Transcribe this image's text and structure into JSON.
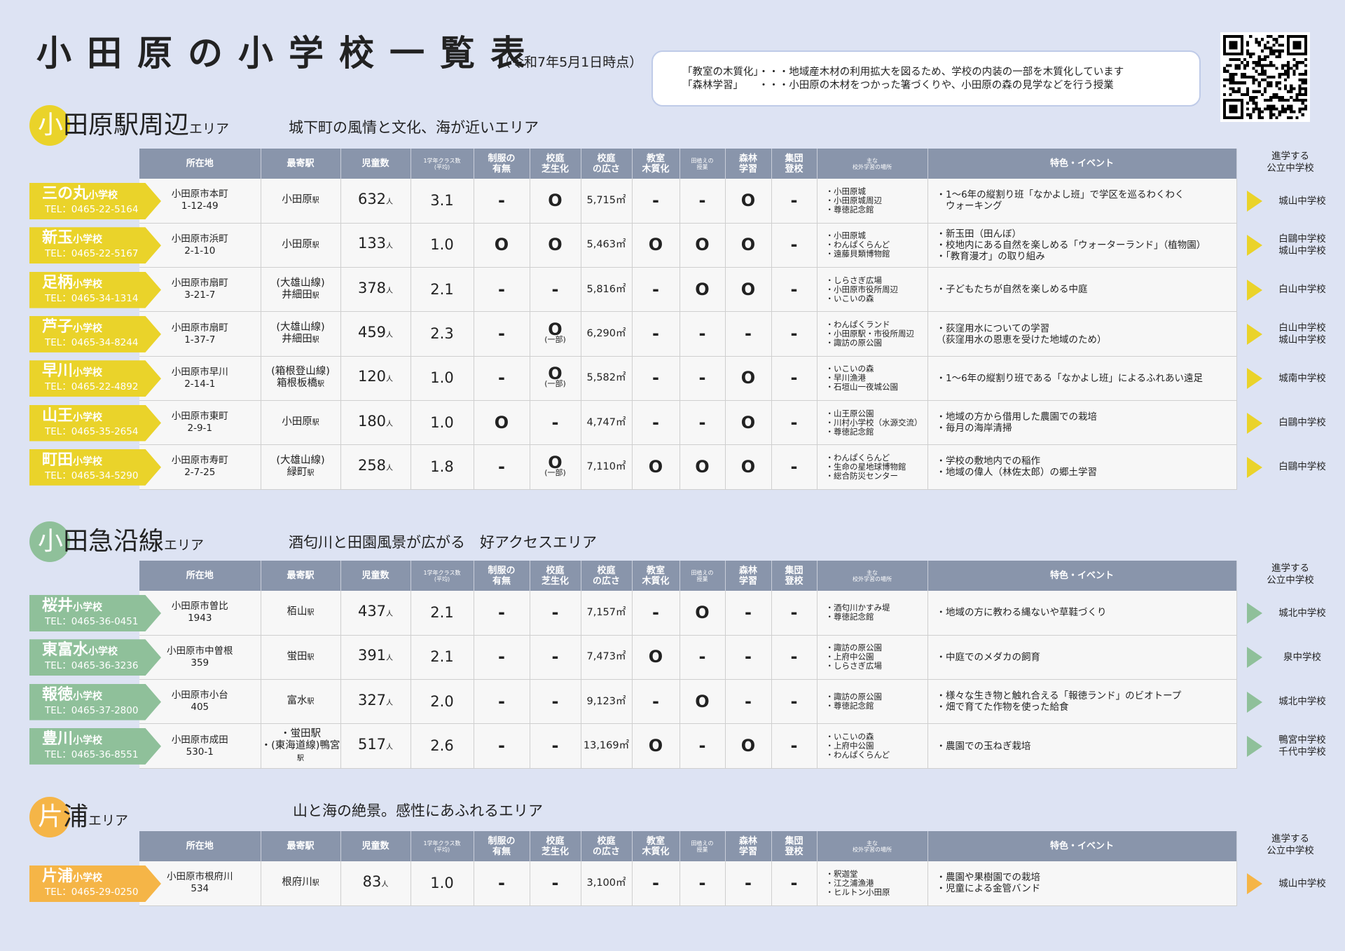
{
  "title": "小田原の小学校一覧表",
  "date": "（令和7年5月1日時点）",
  "note": {
    "line1": "「教室の木質化」・・・地域産木材の利用拡大を図るため、学校の内装の一部を木質化しています",
    "line2": "「森林学習」　　・・・小田原の木材をつかった箸づくりや、小田原の森の見学などを行う授業"
  },
  "colors": {
    "area1": "#ead32a",
    "area2": "#8fc09a",
    "area3": "#f5b547",
    "header": "#8995ab"
  },
  "headers": {
    "address": "所在地",
    "station": "最寄駅",
    "pupils": "児童数",
    "classes": "1学年クラス数",
    "classes_sub": "(平均)",
    "uniform1": "制服の",
    "uniform2": "有無",
    "lawn1": "校庭",
    "lawn2": "芝生化",
    "size1": "校庭",
    "size2": "の広さ",
    "wood1": "教室",
    "wood2": "木質化",
    "rice1": "田植えの",
    "rice2": "授業",
    "forest1": "森林",
    "forest2": "学習",
    "group1": "集団",
    "group2": "登校",
    "places1": "主な",
    "places2": "校外学習の場所",
    "features": "特色・イベント",
    "ms1": "進学する",
    "ms2": "公立中学校"
  },
  "areas": [
    {
      "name_first": "小",
      "name_rest": "田原駅周辺",
      "suffix": "エリア",
      "desc": "城下町の風情と文化、海が近いエリア",
      "schools": [
        {
          "name": "三の丸",
          "kind": "小学校",
          "tel": "TEL：0465-22-5164",
          "addr1": "小田原市本町",
          "addr2": "1-12-49",
          "st_line": "",
          "station": "小田原",
          "st_suffix": "駅",
          "pupils": "632",
          "unit": "人",
          "classes": "3.1",
          "uniform": "-",
          "lawn": "O",
          "lawn_note": "",
          "size": "5,715㎡",
          "wood": "-",
          "rice": "-",
          "forest": "O",
          "group": "-",
          "places": [
            "・小田原城",
            "・小田原城周辺",
            "・尊徳記念館"
          ],
          "features": [
            "・1～6年の縦割り班「なかよし班」で学区を巡るわくわく",
            "　ウォーキング"
          ],
          "ms": [
            "城山中学校"
          ]
        },
        {
          "name": "新玉",
          "kind": "小学校",
          "tel": "TEL：0465-22-5167",
          "addr1": "小田原市浜町",
          "addr2": "2-1-10",
          "st_line": "",
          "station": "小田原",
          "st_suffix": "駅",
          "pupils": "133",
          "unit": "人",
          "classes": "1.0",
          "uniform": "O",
          "lawn": "O",
          "lawn_note": "",
          "size": "5,463㎡",
          "wood": "O",
          "rice": "O",
          "forest": "O",
          "group": "-",
          "places": [
            "・小田原城",
            "・わんぱくらんど",
            "・遠藤貝類博物館"
          ],
          "features": [
            "・新玉田（田んぼ）",
            "・校地内にある自然を楽しめる「ウォーターランド」（植物園）",
            "・「教育漫才」の取り組み"
          ],
          "ms": [
            "白鷗中学校",
            "城山中学校"
          ]
        },
        {
          "name": "足柄",
          "kind": "小学校",
          "tel": "TEL：0465-34-1314",
          "addr1": "小田原市扇町",
          "addr2": "3-21-7",
          "st_line": "(大雄山線)",
          "station": "井細田",
          "st_suffix": "駅",
          "pupils": "378",
          "unit": "人",
          "classes": "2.1",
          "uniform": "-",
          "lawn": "-",
          "lawn_note": "",
          "size": "5,816㎡",
          "wood": "-",
          "rice": "O",
          "forest": "O",
          "group": "-",
          "places": [
            "・しらさぎ広場",
            "・小田原市役所周辺",
            "・いこいの森"
          ],
          "features": [
            "・子どもたちが自然を楽しめる中庭"
          ],
          "ms": [
            "白山中学校"
          ]
        },
        {
          "name": "芦子",
          "kind": "小学校",
          "tel": "TEL：0465-34-8244",
          "addr1": "小田原市扇町",
          "addr2": "1-37-7",
          "st_line": "(大雄山線)",
          "station": "井細田",
          "st_suffix": "駅",
          "pupils": "459",
          "unit": "人",
          "classes": "2.3",
          "uniform": "-",
          "lawn": "O",
          "lawn_note": "(一部)",
          "size": "6,290㎡",
          "wood": "-",
          "rice": "-",
          "forest": "-",
          "group": "-",
          "places": [
            "・わんぱくランド",
            "・小田原駅・市役所周辺",
            "・諏訪の原公園"
          ],
          "features": [
            "・荻窪用水についての学習",
            "（荻窪用水の恩恵を受けた地域のため）"
          ],
          "ms": [
            "白山中学校",
            "城山中学校"
          ]
        },
        {
          "name": "早川",
          "kind": "小学校",
          "tel": "TEL：0465-22-4892",
          "addr1": "小田原市早川",
          "addr2": "2-14-1",
          "st_line": "(箱根登山線)",
          "station": "箱根板橋",
          "st_suffix": "駅",
          "pupils": "120",
          "unit": "人",
          "classes": "1.0",
          "uniform": "-",
          "lawn": "O",
          "lawn_note": "(一部)",
          "size": "5,582㎡",
          "wood": "-",
          "rice": "-",
          "forest": "O",
          "group": "-",
          "places": [
            "・いこいの森",
            "・早川漁港",
            "・石垣山一夜城公園"
          ],
          "features": [
            "・1～6年の縦割り班である「なかよし班」によるふれあい遠足"
          ],
          "ms": [
            "城南中学校"
          ]
        },
        {
          "name": "山王",
          "kind": "小学校",
          "tel": "TEL：0465-35-2654",
          "addr1": "小田原市東町",
          "addr2": "2-9-1",
          "st_line": "",
          "station": "小田原",
          "st_suffix": "駅",
          "pupils": "180",
          "unit": "人",
          "classes": "1.0",
          "uniform": "O",
          "lawn": "-",
          "lawn_note": "",
          "size": "4,747㎡",
          "wood": "-",
          "rice": "-",
          "forest": "O",
          "group": "-",
          "places": [
            "・山王原公園",
            "・川村小学校（水源交流）",
            "・尊徳記念館"
          ],
          "features": [
            "・地域の方から借用した農園での栽培",
            "・毎月の海岸清掃"
          ],
          "ms": [
            "白鷗中学校"
          ]
        },
        {
          "name": "町田",
          "kind": "小学校",
          "tel": "TEL：0465-34-5290",
          "addr1": "小田原市寿町",
          "addr2": "2-7-25",
          "st_line": "(大雄山線)",
          "station": "緑町",
          "st_suffix": "駅",
          "pupils": "258",
          "unit": "人",
          "classes": "1.8",
          "uniform": "-",
          "lawn": "O",
          "lawn_note": "(一部)",
          "size": "7,110㎡",
          "wood": "O",
          "rice": "O",
          "forest": "O",
          "group": "-",
          "places": [
            "・わんぱくらんど",
            "・生命の星地球博物館",
            "・総合防災センター"
          ],
          "features": [
            "・学校の敷地内での稲作",
            "・地域の偉人（林佐太郎）の郷土学習"
          ],
          "ms": [
            "白鷗中学校"
          ]
        }
      ]
    },
    {
      "name_first": "小",
      "name_rest": "田急沿線",
      "suffix": "エリア",
      "desc": "酒匂川と田園風景が広がる　好アクセスエリア",
      "schools": [
        {
          "name": "桜井",
          "kind": "小学校",
          "tel": "TEL：0465-36-0451",
          "addr1": "小田原市曽比",
          "addr2": "1943",
          "st_line": "",
          "station": "栢山",
          "st_suffix": "駅",
          "pupils": "437",
          "unit": "人",
          "classes": "2.1",
          "uniform": "-",
          "lawn": "-",
          "lawn_note": "",
          "size": "7,157㎡",
          "wood": "-",
          "rice": "O",
          "forest": "-",
          "group": "-",
          "places": [
            "・酒匂川かすみ堤",
            "・尊徳記念館"
          ],
          "features": [
            "・地域の方に教わる縄ないや草鞋づくり"
          ],
          "ms": [
            "城北中学校"
          ]
        },
        {
          "name": "東富水",
          "kind": "小学校",
          "tel": "TEL：0465-36-3236",
          "addr1": "小田原市中曽根",
          "addr2": "359",
          "st_line": "",
          "station": "蛍田",
          "st_suffix": "駅",
          "pupils": "391",
          "unit": "人",
          "classes": "2.1",
          "uniform": "-",
          "lawn": "-",
          "lawn_note": "",
          "size": "7,473㎡",
          "wood": "O",
          "rice": "-",
          "forest": "-",
          "group": "-",
          "places": [
            "・諏訪の原公園",
            "・上府中公園",
            "・しらさぎ広場"
          ],
          "features": [
            "・中庭でのメダカの飼育"
          ],
          "ms": [
            "泉中学校"
          ]
        },
        {
          "name": "報徳",
          "kind": "小学校",
          "tel": "TEL：0465-37-2800",
          "addr1": "小田原市小台",
          "addr2": "405",
          "st_line": "",
          "station": "富水",
          "st_suffix": "駅",
          "pupils": "327",
          "unit": "人",
          "classes": "2.0",
          "uniform": "-",
          "lawn": "-",
          "lawn_note": "",
          "size": "9,123㎡",
          "wood": "-",
          "rice": "O",
          "forest": "-",
          "group": "-",
          "places": [
            "・諏訪の原公園",
            "・尊徳記念館"
          ],
          "features": [
            "・様々な生き物と触れ合える「報徳ランド」のビオトープ",
            "・畑で育てた作物を使った給食"
          ],
          "ms": [
            "城北中学校"
          ]
        },
        {
          "name": "豊川",
          "kind": "小学校",
          "tel": "TEL：0465-36-8551",
          "addr1": "小田原市成田",
          "addr2": "530-1",
          "st_line": "・蛍田駅",
          "station": "・(東海道線)鴨宮",
          "st_suffix": "駅",
          "pupils": "517",
          "unit": "人",
          "classes": "2.6",
          "uniform": "-",
          "lawn": "-",
          "lawn_note": "",
          "size": "13,169㎡",
          "wood": "O",
          "rice": "-",
          "forest": "O",
          "group": "-",
          "places": [
            "・いこいの森",
            "・上府中公園",
            "・わんぱくらんど"
          ],
          "features": [
            "・農園での玉ねぎ栽培"
          ],
          "ms": [
            "鴨宮中学校",
            "千代中学校"
          ]
        }
      ]
    },
    {
      "name_first": "片",
      "name_rest": "浦",
      "suffix": "エリア",
      "desc": "山と海の絶景。感性にあふれるエリア",
      "schools": [
        {
          "name": "片浦",
          "kind": "小学校",
          "tel": "TEL：0465-29-0250",
          "addr1": "小田原市根府川",
          "addr2": "534",
          "st_line": "",
          "station": "根府川",
          "st_suffix": "駅",
          "pupils": "83",
          "unit": "人",
          "classes": "1.0",
          "uniform": "-",
          "lawn": "-",
          "lawn_note": "",
          "size": "3,100㎡",
          "wood": "-",
          "rice": "-",
          "forest": "-",
          "group": "-",
          "places": [
            "・釈迦堂",
            "・江之浦漁港",
            "・ヒルトン小田原"
          ],
          "features": [
            "・農園や果樹園での栽培",
            "・児童による金管バンド"
          ],
          "ms": [
            "城山中学校"
          ]
        }
      ]
    }
  ]
}
